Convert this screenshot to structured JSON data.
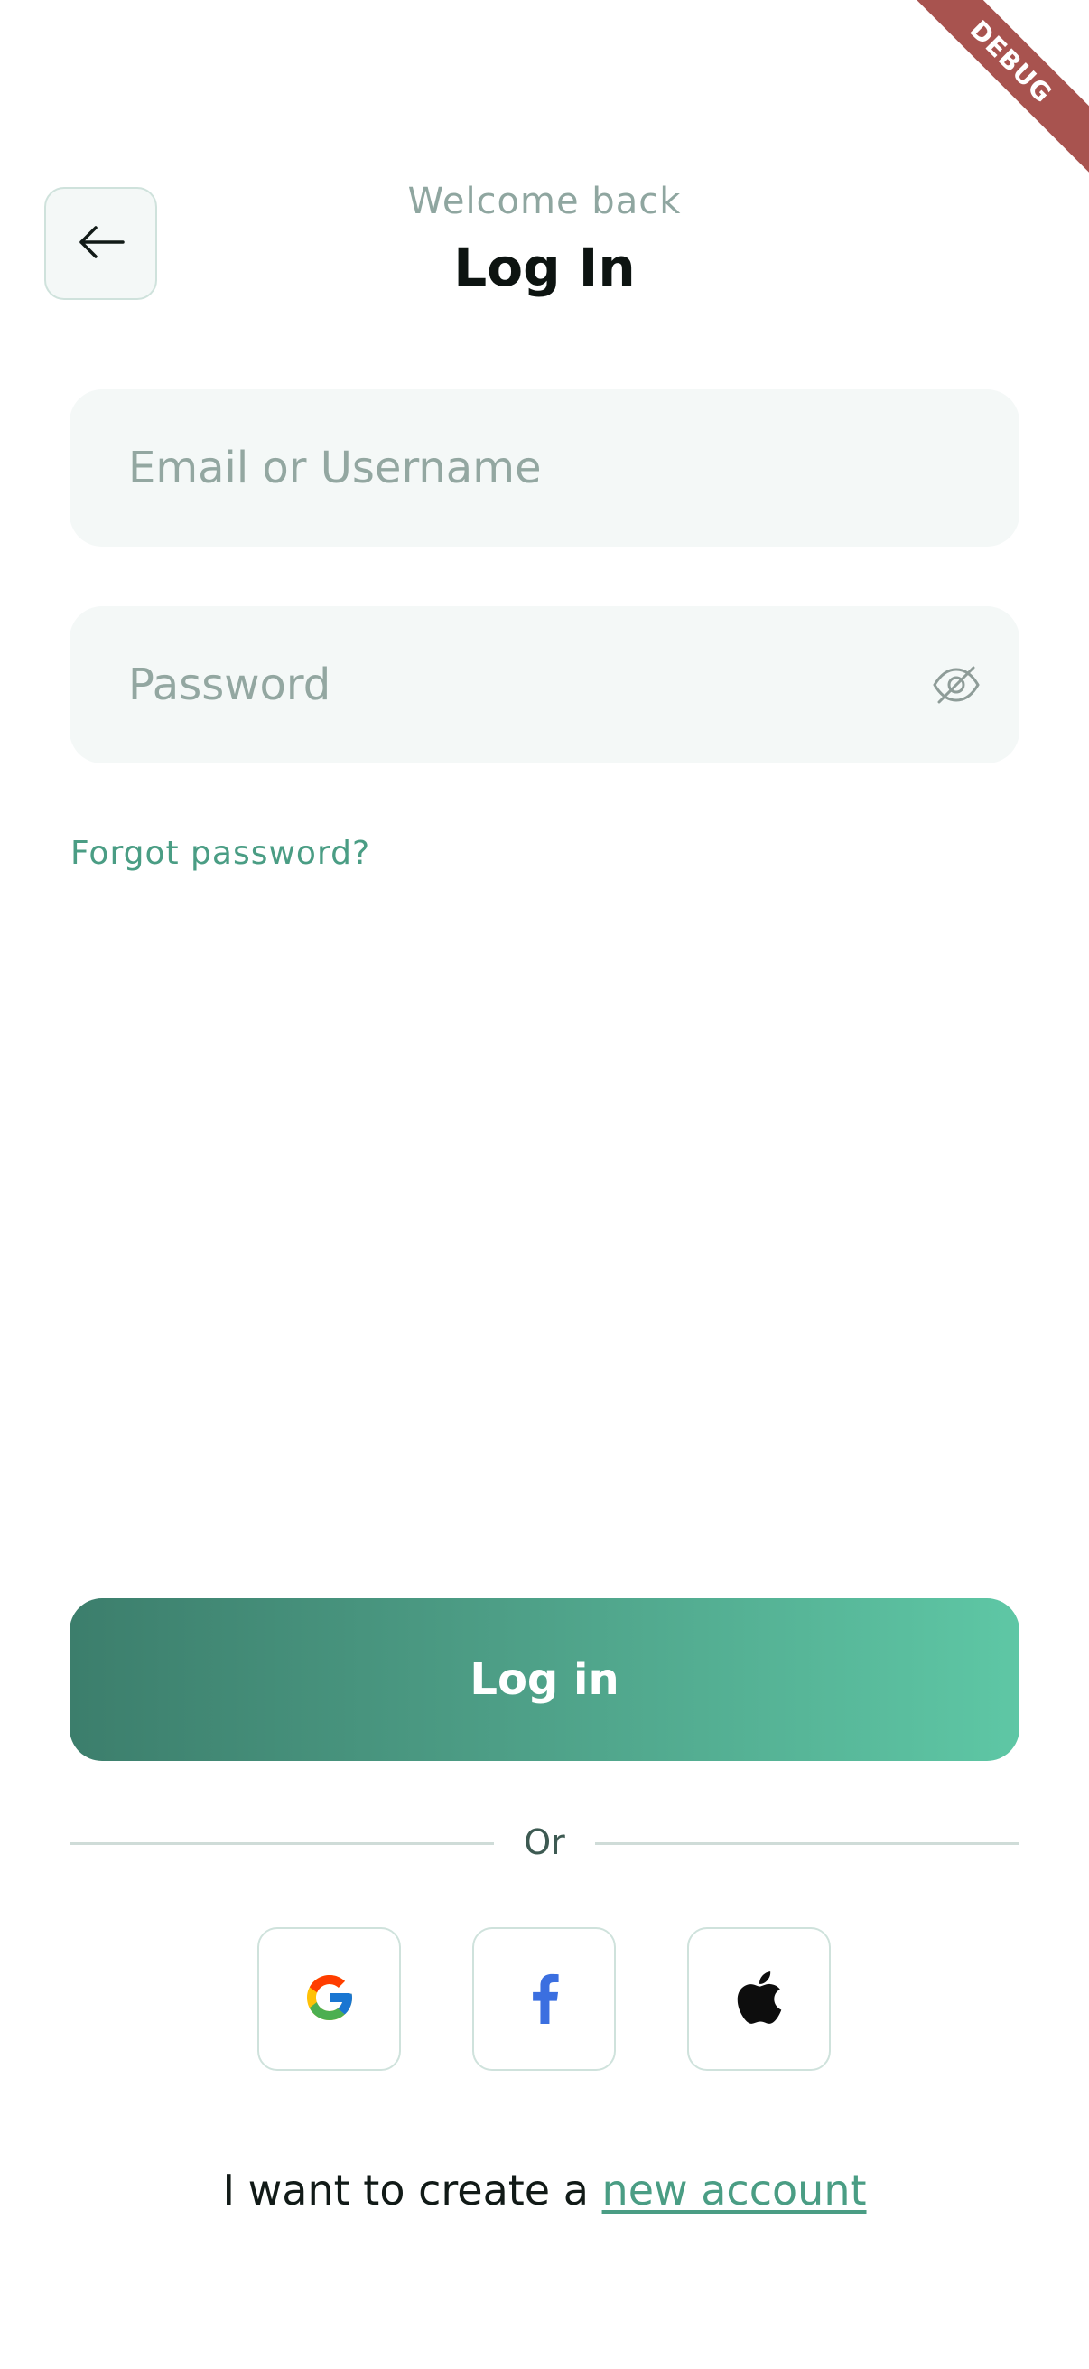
{
  "debug_banner": {
    "label": "DEBUG",
    "color": "#a8534f"
  },
  "header": {
    "subtitle": "Welcome back",
    "title": "Log In",
    "back_icon": "arrow-left-icon"
  },
  "form": {
    "email": {
      "placeholder": "Email or Username",
      "value": ""
    },
    "password": {
      "placeholder": "Password",
      "value": "",
      "toggle_icon": "eye-off-icon"
    },
    "forgot_label": "Forgot password?"
  },
  "actions": {
    "login_label": "Log in",
    "or_label": "Or",
    "social": [
      {
        "name": "google",
        "icon": "google-icon"
      },
      {
        "name": "facebook",
        "icon": "facebook-icon"
      },
      {
        "name": "apple",
        "icon": "apple-icon"
      }
    ]
  },
  "footer": {
    "prefix": "I want to create a ",
    "link": "new account"
  },
  "colors": {
    "accent": "#4a9d84",
    "gradient_start": "#3c7e6c",
    "gradient_end": "#5ec7a5",
    "field_bg": "#f4f8f7"
  }
}
